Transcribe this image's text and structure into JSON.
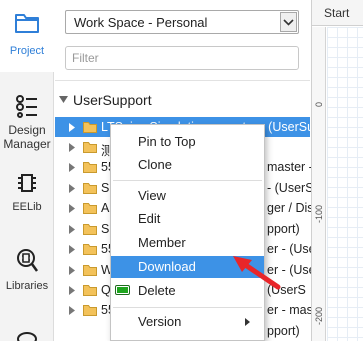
{
  "sidebar": {
    "items": [
      {
        "label": "Project"
      },
      {
        "label_line1": "Design",
        "label_line2": "Manager"
      },
      {
        "label": "EELib"
      },
      {
        "label": "Libraries"
      }
    ]
  },
  "panel": {
    "workspace_select": {
      "value": "Work Space - Personal"
    },
    "filter": {
      "placeholder": "Filter",
      "value": ""
    },
    "tree": {
      "root_label": "UserSupport",
      "rows": [
        {
          "text": "LTSpice Simulation - master - (UserSu"
        },
        {
          "text": "测"
        },
        {
          "text": "55"
        },
        {
          "text": "S"
        },
        {
          "text": "Ar"
        },
        {
          "text": "S"
        },
        {
          "text": "55"
        },
        {
          "text": "W"
        },
        {
          "text": "Q"
        },
        {
          "text": "55"
        }
      ],
      "row_suffixes": [
        {
          "text": "master -"
        },
        {
          "text": "- (UserS"
        },
        {
          "text": "ger / Disc"
        },
        {
          "text": "pport)"
        },
        {
          "text": "er - (Use"
        },
        {
          "text": "er - (Use"
        },
        {
          "text": "(UserS"
        },
        {
          "text": "er - mast"
        },
        {
          "text": "pport)"
        }
      ]
    }
  },
  "canvas": {
    "tab_label": "Start",
    "ruler_labels": [
      "0",
      "-100",
      "-200"
    ]
  },
  "context_menu": {
    "items": [
      {
        "label": "Pin to Top"
      },
      {
        "label": "Clone"
      },
      {
        "label": "View"
      },
      {
        "label": "Edit"
      },
      {
        "label": "Member"
      },
      {
        "label": "Download"
      },
      {
        "label": "Delete"
      },
      {
        "label": "Version"
      }
    ],
    "highlighted": "Download"
  },
  "colors": {
    "accent": "#3d92e6",
    "folder": "#f3c25a",
    "annotation_arrow": "#e8262a",
    "delete_icon": "#1ea51e"
  }
}
